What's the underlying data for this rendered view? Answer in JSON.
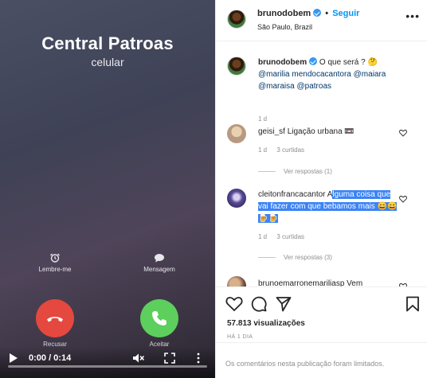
{
  "video": {
    "caller_name": "Central Patroas",
    "caller_type": "celular",
    "remind_label": "Lembre-me",
    "message_label": "Mensagem",
    "decline_label": "Recusar",
    "accept_label": "Aceitar",
    "timecode": "0:00 / 0:14",
    "progress": 0,
    "icons": [
      "alarm-icon",
      "speech-bubble-icon",
      "phone-hangup-icon",
      "phone-icon",
      "play-icon",
      "muted-speaker-icon",
      "fullscreen-icon",
      "more-vertical-icon"
    ],
    "colors": {
      "decline": "#e5483e",
      "accept": "#5ccf5c"
    }
  },
  "post": {
    "username": "brunodobem",
    "follow_label": "Seguir",
    "location": "São Paulo, Brazil",
    "caption": {
      "username": "brunodobem",
      "text": "O que será ? 🤔",
      "mentions": "@marilia mendocacantora @maiara @maraisa @patroas",
      "time": "1 d"
    },
    "comments": [
      {
        "username": "geisi_sf",
        "text": "Ligação urbana 📼",
        "time": "1 d",
        "likes": "3 curtidas",
        "replies": "Ver respostas (1)"
      },
      {
        "username": "cleitonfrancacantor",
        "text_plain": "A",
        "text_highlighted": "lguma coisa que vai fazer com que bebamos mais 😄😄🍺🍺",
        "time": "1 d",
        "likes": "3 curtidas",
        "replies": "Ver respostas (3)"
      },
      {
        "username": "brunoemarronemariliasp",
        "text": "Vem"
      }
    ],
    "views": "57.813 visualizações",
    "posted_ago": "HÁ 1 DIA",
    "comments_limited": "Os comentários nesta publicação foram limitados.",
    "colors": {
      "accent": "#0095f6",
      "mention": "#00376b",
      "highlight": "#3b83f6"
    }
  }
}
